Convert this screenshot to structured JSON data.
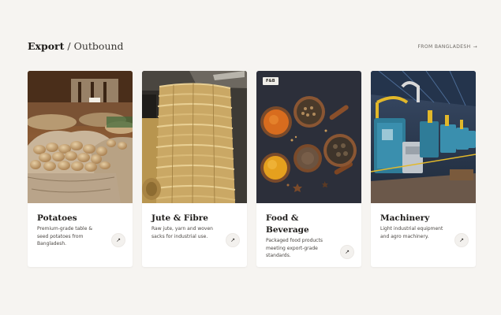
{
  "header": {
    "title_strong": "Export",
    "title_sep": " / ",
    "title_light": "Outbound",
    "from_link": "FROM BANGLADESH",
    "from_link_arrow": "→"
  },
  "cards": [
    {
      "name": "Potatoes",
      "description": "Premium-grade table & seed potatoes from Bangladesh.",
      "arrow": "↗",
      "image_icon": "potato-sacks-image"
    },
    {
      "name": "Jute & Fibre",
      "description": "Raw jute, yarn and woven sacks for industrial use.",
      "arrow": "↗",
      "image_icon": "jute-bundles-image"
    },
    {
      "name": "Food &",
      "name_line2": "Beverage",
      "badge": "F&B",
      "description": "Packaged food products meeting export-grade standards.",
      "arrow": "↗",
      "image_icon": "spice-bowls-image"
    },
    {
      "name": "Machinery",
      "description": "Light industrial equipment and agro machinery.",
      "arrow": "↗",
      "image_icon": "factory-machines-image"
    }
  ]
}
